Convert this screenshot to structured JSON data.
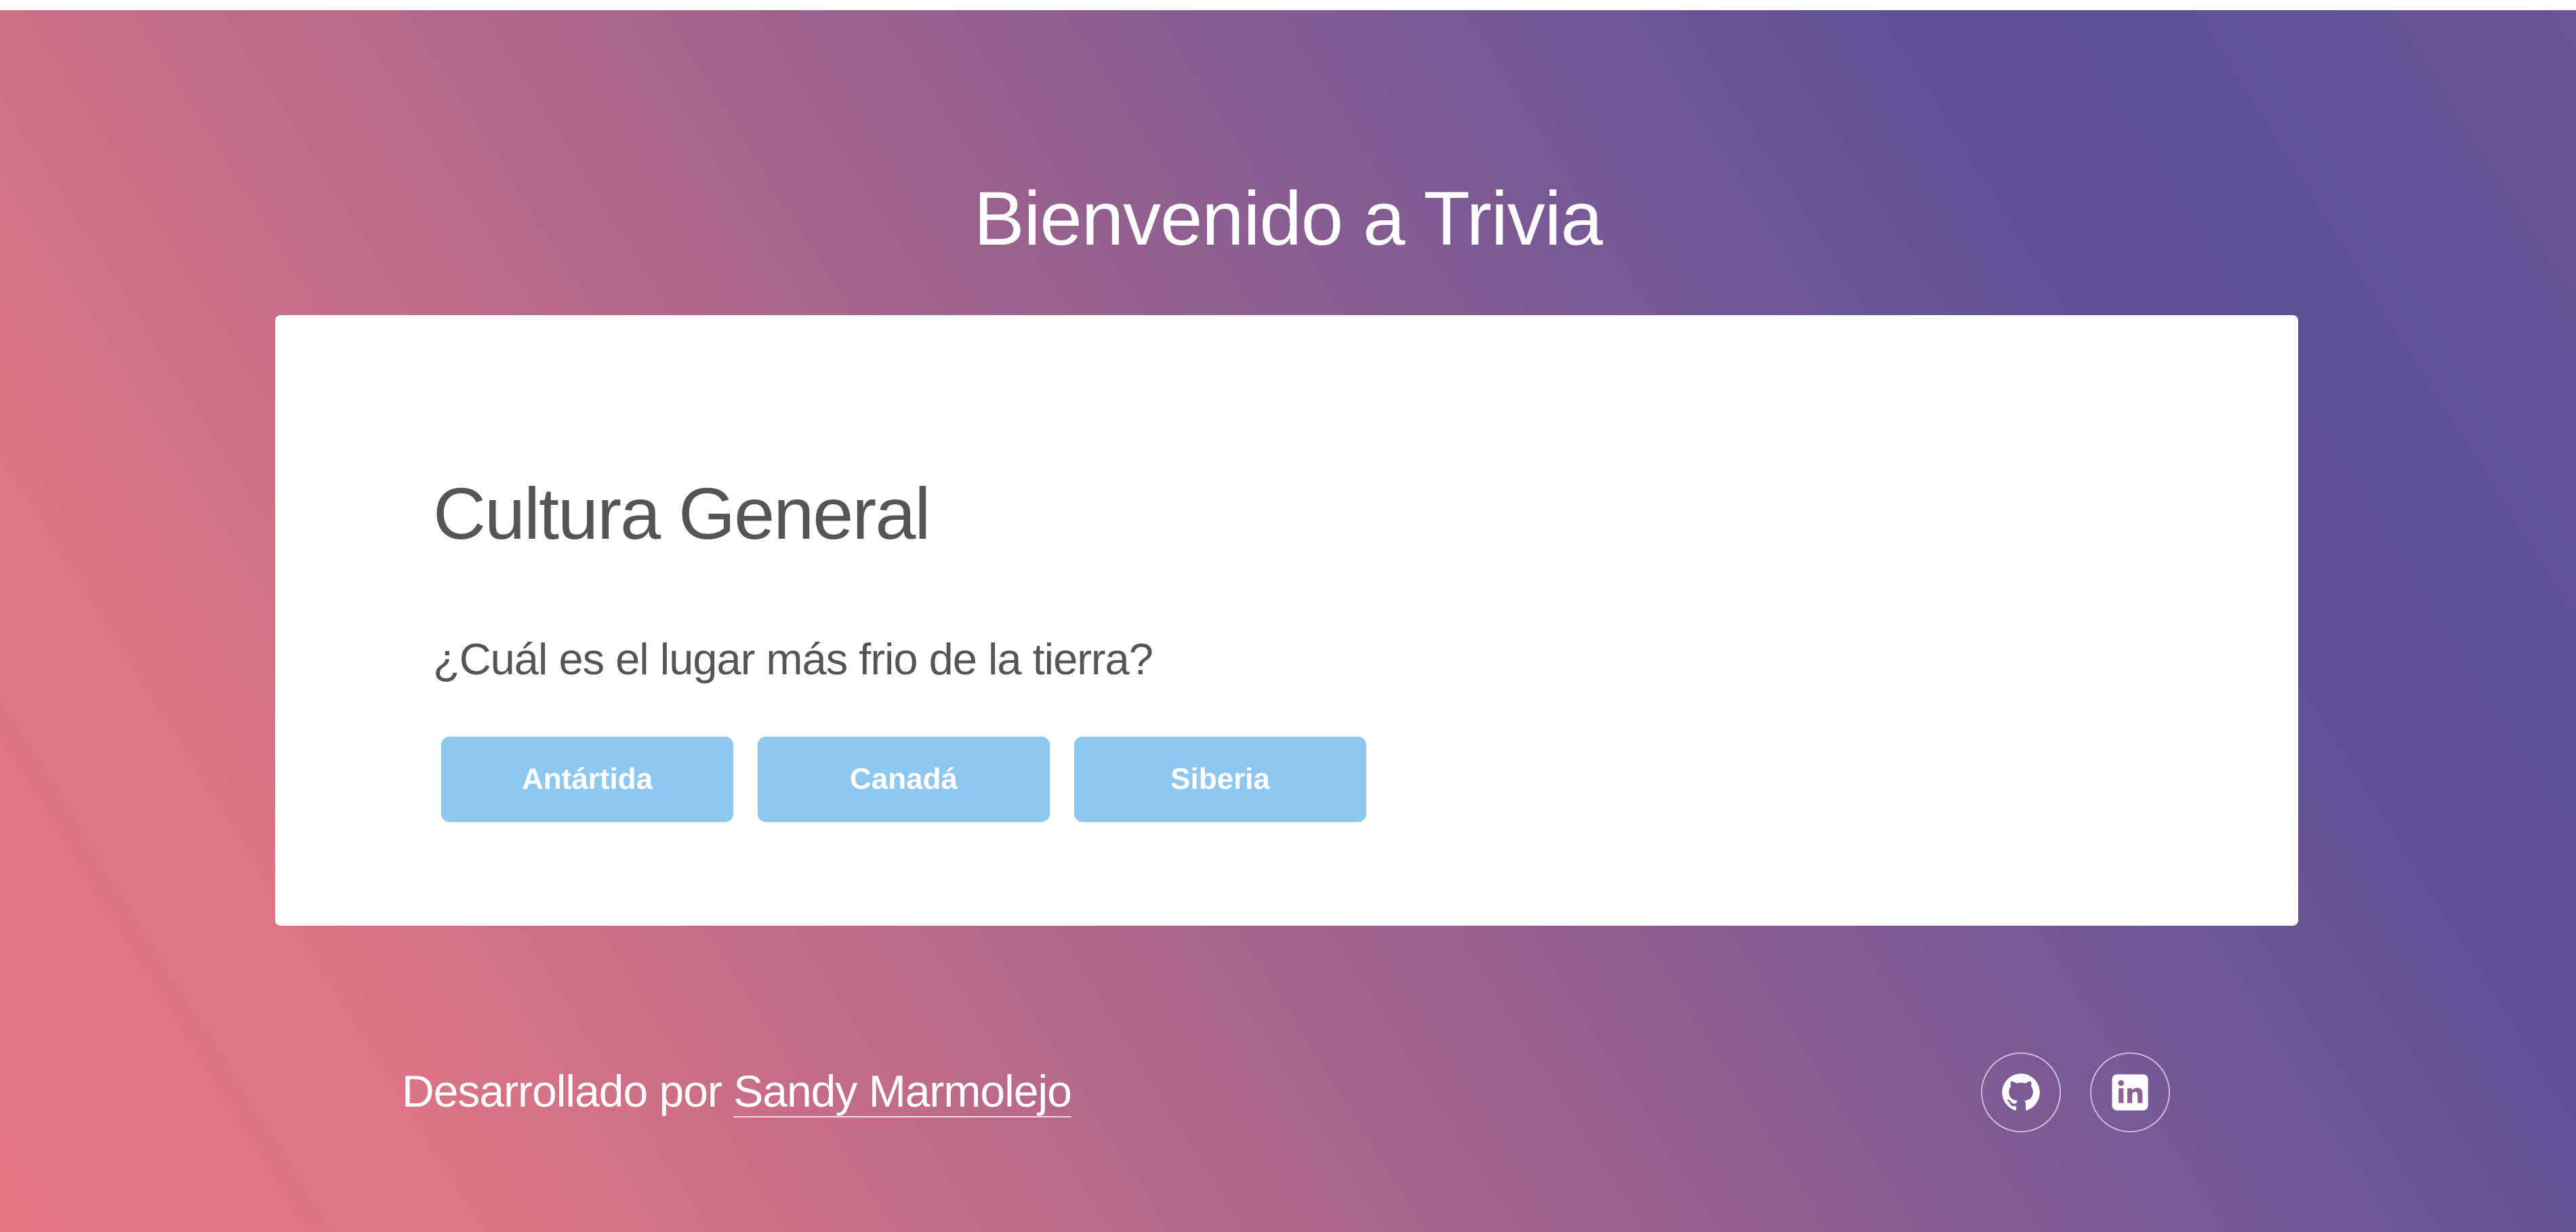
{
  "page": {
    "title": "Bienvenido a Trivia"
  },
  "quiz": {
    "category": "Cultura General",
    "question": "¿Cuál es el lugar más frio de la tierra?",
    "answers": [
      "Antártida",
      "Canadá",
      "Siberia"
    ]
  },
  "footer": {
    "prefix": "Desarrollado por ",
    "author": "Sandy Marmolejo",
    "social": [
      {
        "icon": "github-icon"
      },
      {
        "icon": "linkedin-icon"
      }
    ]
  },
  "colors": {
    "answer_button": "#8ec8f0",
    "card_background": "#ffffff",
    "gradient_start": "#e27482",
    "gradient_end": "#5f5097"
  }
}
